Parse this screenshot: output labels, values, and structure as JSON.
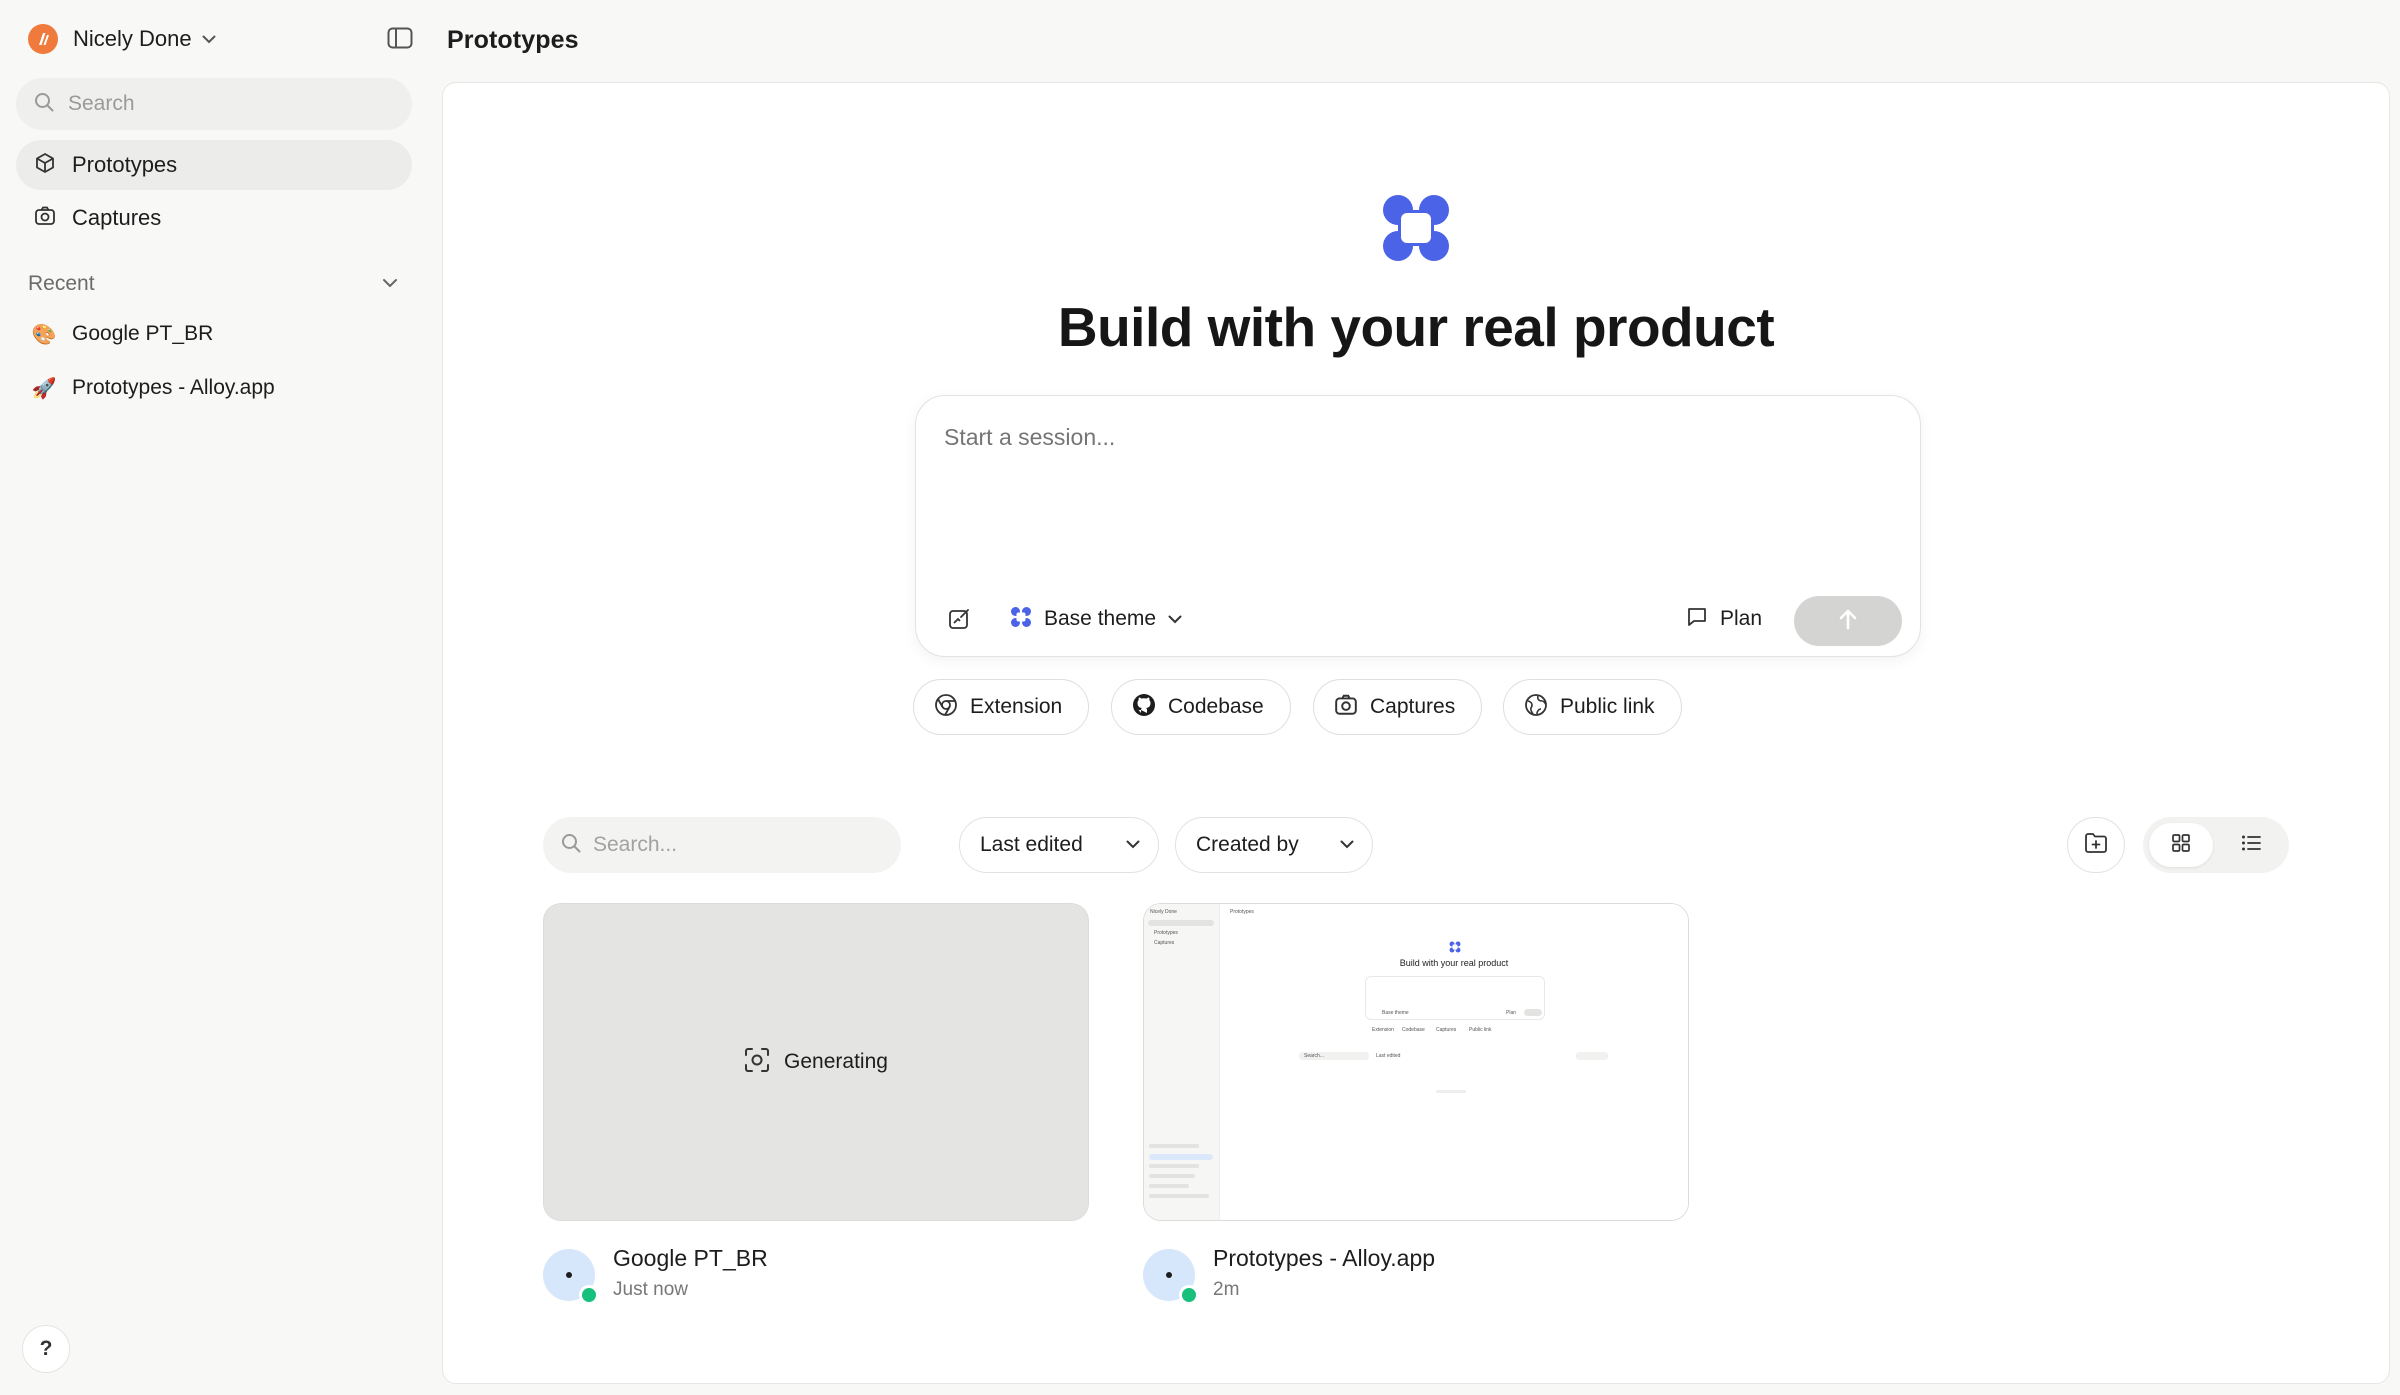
{
  "workspace": {
    "name": "Nicely Done"
  },
  "sidebar": {
    "search_placeholder": "Search",
    "nav": [
      {
        "label": "Prototypes",
        "icon": "cube-icon",
        "active": true
      },
      {
        "label": "Captures",
        "icon": "camera-icon",
        "active": false
      }
    ],
    "recent_label": "Recent",
    "recent": [
      {
        "label": "Google PT_BR",
        "emoji": "🎨"
      },
      {
        "label": "Prototypes - Alloy.app",
        "emoji": "🚀"
      }
    ],
    "help_label": "?"
  },
  "header": {
    "title": "Prototypes"
  },
  "hero": {
    "title": "Build with your real product",
    "brand_color": "#4a63e7"
  },
  "composer": {
    "placeholder": "Start a session...",
    "theme_label": "Base theme",
    "plan_label": "Plan"
  },
  "chips": [
    {
      "label": "Extension",
      "icon": "chrome-icon"
    },
    {
      "label": "Codebase",
      "icon": "github-icon"
    },
    {
      "label": "Captures",
      "icon": "camera-icon"
    },
    {
      "label": "Public link",
      "icon": "globe-icon"
    }
  ],
  "toolbar": {
    "search_placeholder": "Search...",
    "sort_label": "Last edited",
    "filter_label": "Created by",
    "view": "grid"
  },
  "cards": [
    {
      "title": "Google PT_BR",
      "time": "Just now",
      "state": "Generating"
    },
    {
      "title": "Prototypes - Alloy.app",
      "time": "2m",
      "preview": {
        "workspace": "Nicely Done",
        "header": "Prototypes",
        "nav": [
          "Prototypes",
          "Captures"
        ],
        "title": "Build with your real product",
        "theme": "Base theme",
        "plan": "Plan",
        "chips": [
          "Extension",
          "Codebase",
          "Captures",
          "Public link"
        ],
        "search": "Search...",
        "sort": "Last edited"
      }
    }
  ]
}
